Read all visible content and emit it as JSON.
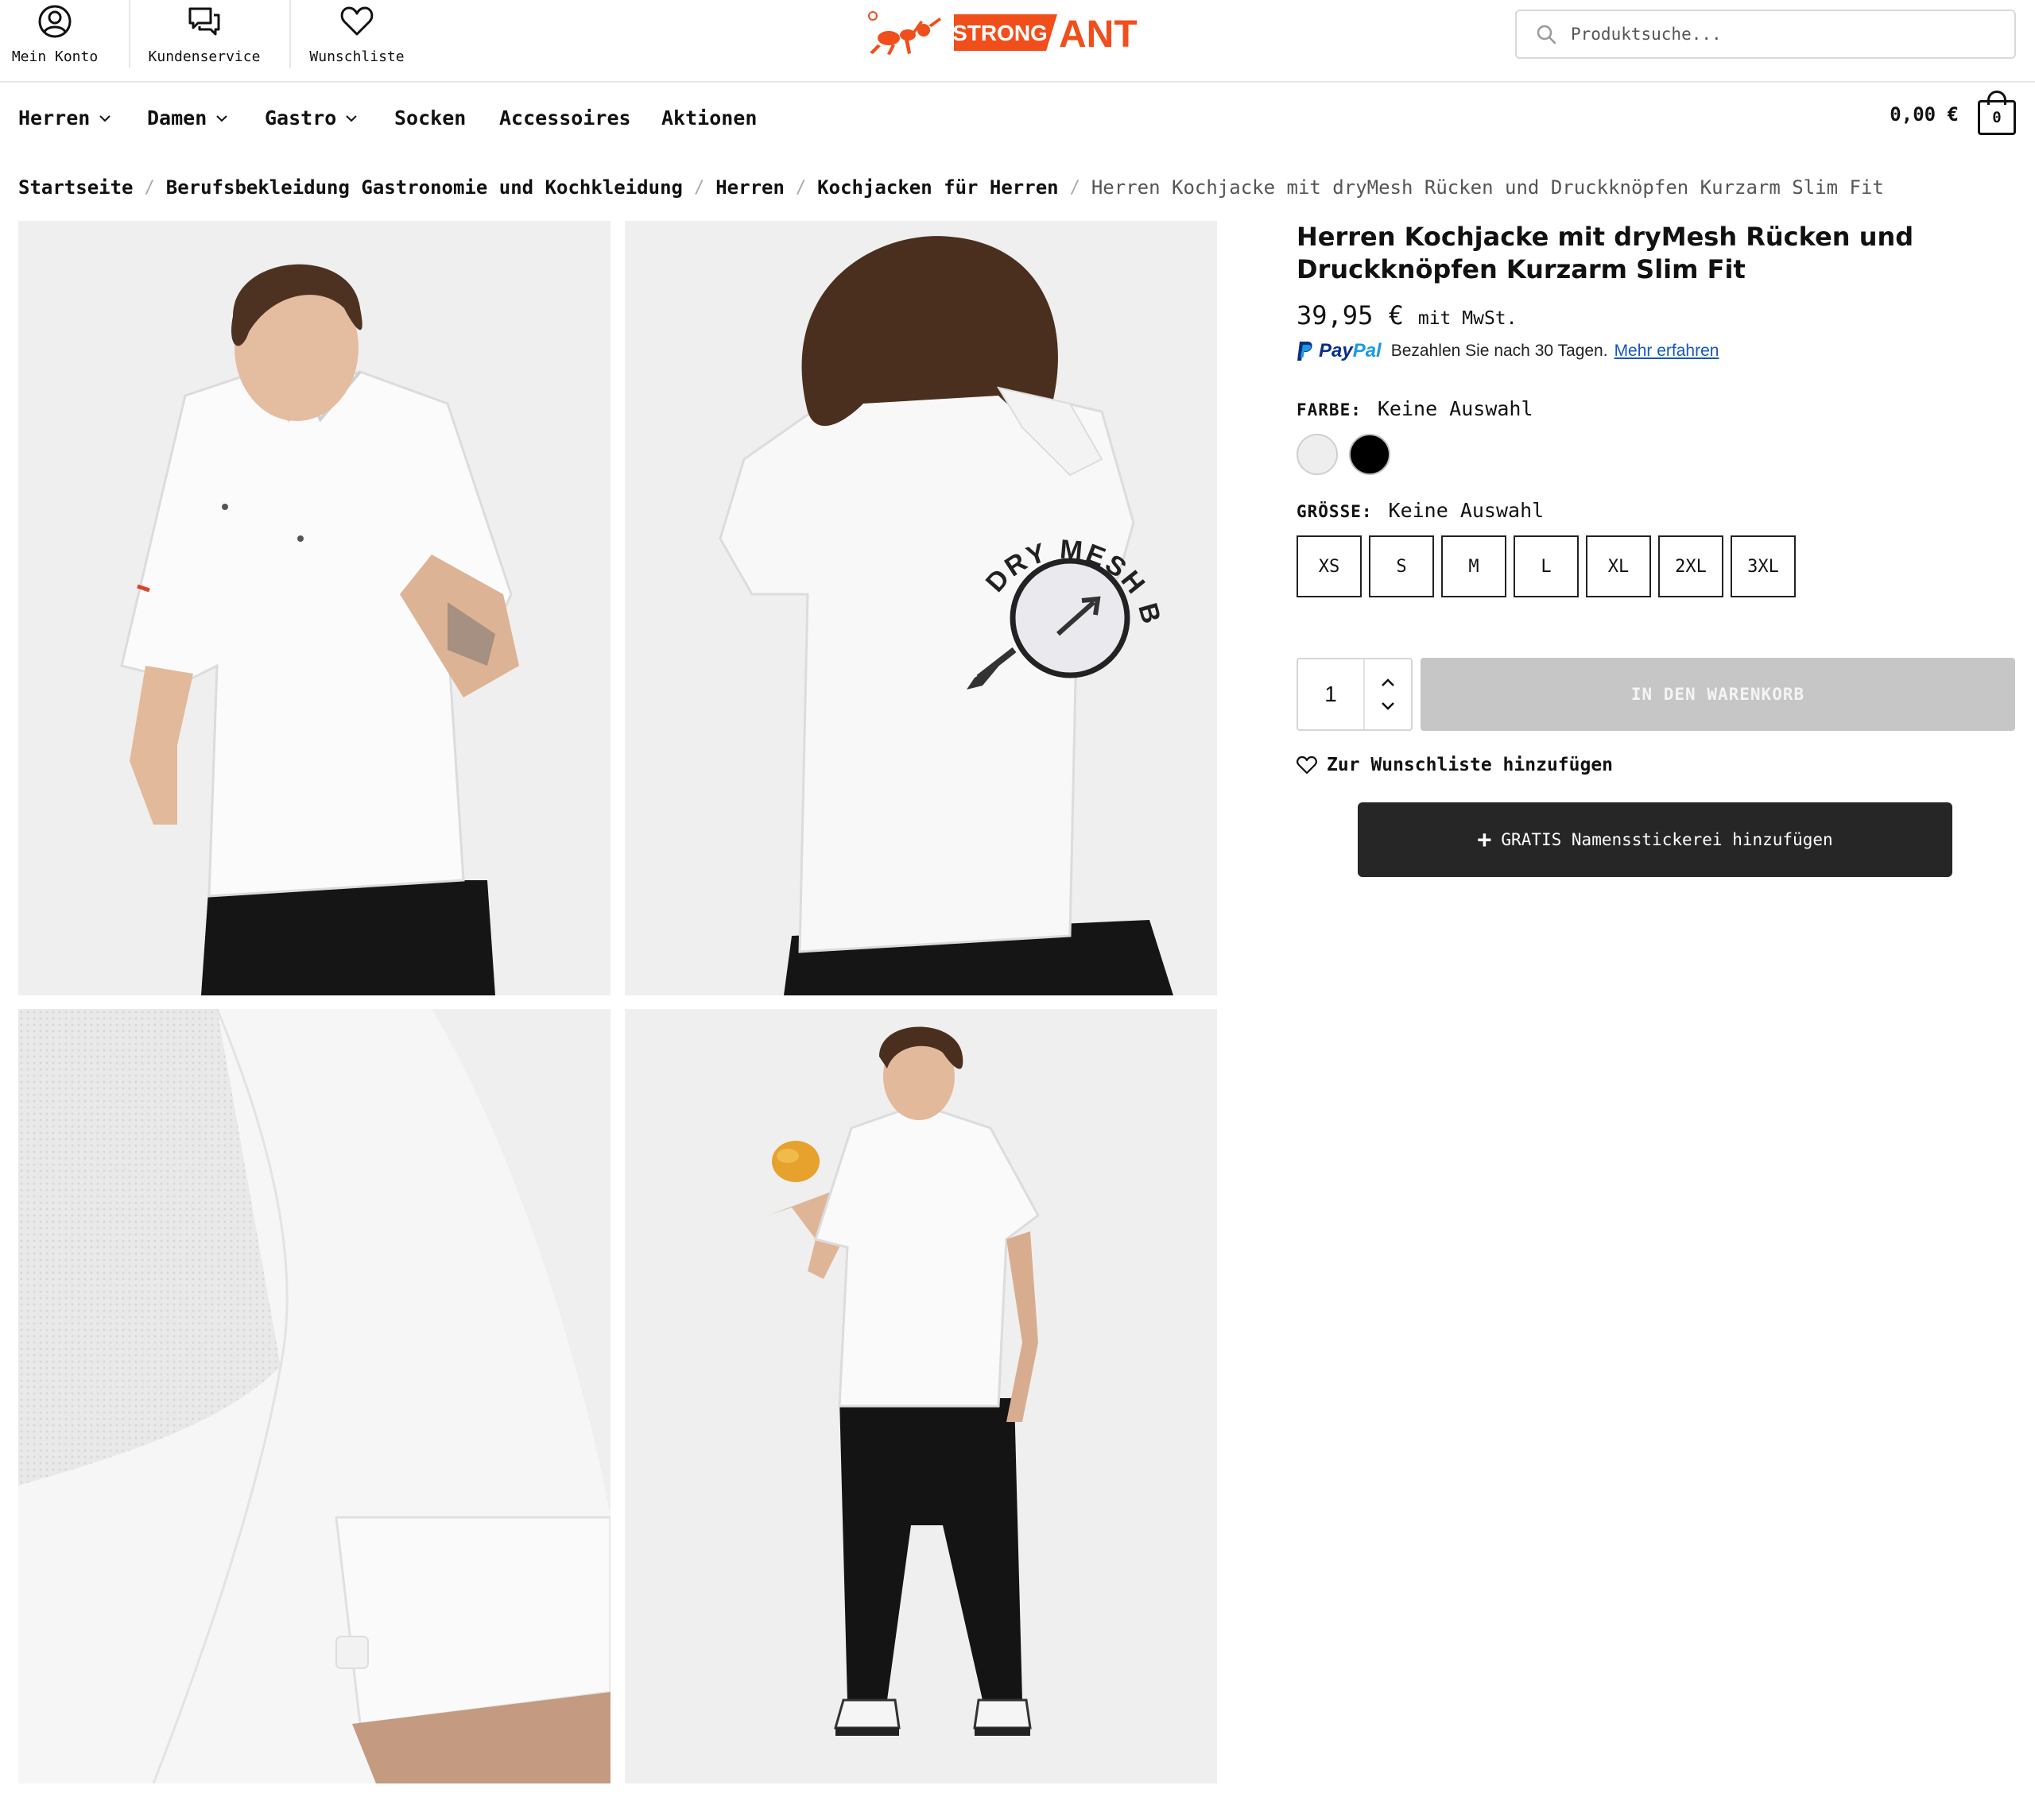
{
  "header": {
    "utility_links": [
      {
        "label": "Mein Konto",
        "icon": "account-icon"
      },
      {
        "label": "Kundenservice",
        "icon": "chat-icon"
      },
      {
        "label": "Wunschliste",
        "icon": "heart-icon"
      }
    ],
    "logo": {
      "text": "STRONG ANT",
      "brand_color": "#f04e1b"
    },
    "search": {
      "placeholder": "Produktsuche...",
      "icon": "search-icon"
    }
  },
  "nav": {
    "items": [
      {
        "label": "Herren",
        "has_dropdown": true
      },
      {
        "label": "Damen",
        "has_dropdown": true
      },
      {
        "label": "Gastro",
        "has_dropdown": true
      },
      {
        "label": "Socken",
        "has_dropdown": false
      },
      {
        "label": "Accessoires",
        "has_dropdown": false
      },
      {
        "label": "Aktionen",
        "has_dropdown": false
      }
    ],
    "cart": {
      "total": "0,00 €",
      "count": "0",
      "icon": "cart-bag-icon"
    }
  },
  "breadcrumb": {
    "links": [
      "Startseite",
      "Berufsbekleidung Gastronomie und Kochkleidung",
      "Herren",
      "Kochjacken für Herren"
    ],
    "separator": "/",
    "current": "Herren Kochjacke mit dryMesh Rücken und Druckknöpfen Kurzarm Slim Fit"
  },
  "gallery": {
    "images": [
      {
        "name": "front-view-photo"
      },
      {
        "name": "back-view-photo",
        "overlay_text": "DRY MESH BACK"
      },
      {
        "name": "sleeve-detail-photo"
      },
      {
        "name": "full-body-photo"
      }
    ]
  },
  "product": {
    "title": "Herren Kochjacke mit dryMesh Rücken und Druckknöpfen Kurzarm Slim Fit",
    "price": "39,95 €",
    "tax_note": "mit MwSt.",
    "paypal": {
      "logo_pay": "Pay",
      "logo_pal": "Pal",
      "text": "Bezahlen Sie nach 30 Tagen.",
      "link": "Mehr erfahren"
    },
    "color": {
      "label": "FARBE:",
      "value": "Keine Auswahl",
      "swatches": [
        {
          "name": "weiss",
          "hex": "#eeeeee"
        },
        {
          "name": "schwarz",
          "hex": "#000000"
        }
      ]
    },
    "size": {
      "label": "GRÖSSE:",
      "value": "Keine Auswahl",
      "options": [
        "XS",
        "S",
        "M",
        "L",
        "XL",
        "2XL",
        "3XL"
      ]
    },
    "quantity": "1",
    "add_to_cart": "IN DEN WARENKORB",
    "wishlist": "Zur Wunschliste hinzufügen",
    "embroidery": {
      "plus": "+",
      "label": "GRATIS Namensstickerei hinzufügen"
    }
  },
  "colors": {
    "brand": "#f04e1b",
    "button_disabled": "#c6c6c6",
    "button_dark": "#262626",
    "paypal_link": "#1557c0",
    "gallery_bg": "#efefef"
  }
}
